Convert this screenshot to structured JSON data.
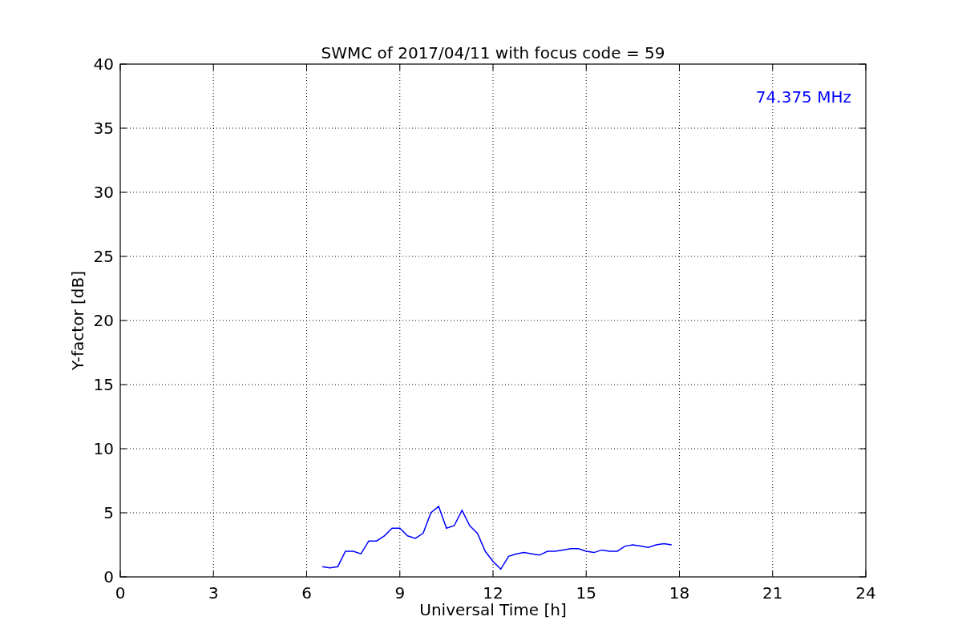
{
  "chart_data": {
    "type": "line",
    "title": "SWMC of 2017/04/11 with focus code = 59",
    "xlabel": "Universal Time [h]",
    "ylabel": "Y-factor [dB]",
    "x": [
      6.5,
      6.75,
      7.0,
      7.25,
      7.5,
      7.75,
      8.0,
      8.25,
      8.5,
      8.75,
      9.0,
      9.25,
      9.5,
      9.75,
      10.0,
      10.25,
      10.5,
      10.75,
      11.0,
      11.25,
      11.5,
      11.75,
      12.0,
      12.25,
      12.5,
      12.75,
      13.0,
      13.25,
      13.5,
      13.75,
      14.0,
      14.25,
      14.5,
      14.75,
      15.0,
      15.25,
      15.5,
      15.75,
      16.0,
      16.25,
      16.5,
      16.75,
      17.0,
      17.25,
      17.5,
      17.75
    ],
    "series": [
      {
        "name": "74.375 MHz",
        "color": "#0000ff",
        "values": [
          0.8,
          0.7,
          0.8,
          2.0,
          2.0,
          1.8,
          2.8,
          2.8,
          3.2,
          3.8,
          3.8,
          3.2,
          3.0,
          3.4,
          5.0,
          5.5,
          3.8,
          4.0,
          5.2,
          4.0,
          3.4,
          2.0,
          1.2,
          0.6,
          1.6,
          1.8,
          1.9,
          1.8,
          1.7,
          2.0,
          2.0,
          2.1,
          2.2,
          2.2,
          2.0,
          1.9,
          2.1,
          2.0,
          2.0,
          2.4,
          2.5,
          2.4,
          2.3,
          2.5,
          2.6,
          2.5
        ]
      }
    ],
    "xlim": [
      0,
      24
    ],
    "ylim": [
      0,
      40
    ],
    "xticks": [
      0,
      3,
      6,
      9,
      12,
      15,
      18,
      21,
      24
    ],
    "yticks": [
      0,
      5,
      10,
      15,
      20,
      25,
      30,
      35,
      40
    ],
    "grid": true
  }
}
